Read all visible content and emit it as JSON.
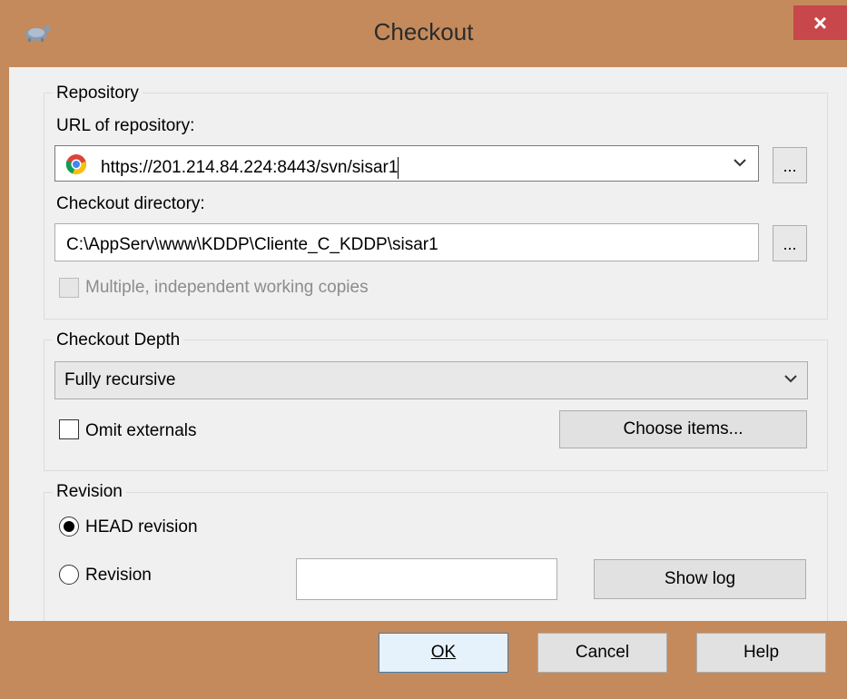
{
  "window": {
    "title": "Checkout",
    "close_label": "×"
  },
  "repository": {
    "group_label": "Repository",
    "url_label": "URL of repository:",
    "url_value": "https://201.214.84.224:8443/svn/sisar1",
    "browse_url_label": "...",
    "dir_label": "Checkout directory:",
    "dir_value": "C:\\AppServ\\www\\KDDP\\Cliente_C_KDDP\\sisar1",
    "browse_dir_label": "...",
    "multiple_copies_label": "Multiple, independent working copies"
  },
  "depth": {
    "group_label": "Checkout Depth",
    "selected": "Fully recursive",
    "omit_externals_label": "Omit externals",
    "choose_items_label": "Choose items..."
  },
  "revision": {
    "group_label": "Revision",
    "head_label": "HEAD revision",
    "revision_label": "Revision",
    "revision_value": "",
    "show_log_label": "Show log"
  },
  "buttons": {
    "ok_label": "OK",
    "cancel_label": "Cancel",
    "help_label": "Help"
  },
  "colors": {
    "title_bar": "#c48a5c",
    "close_button": "#c7474a",
    "dialog_bg": "#f0f0f0",
    "default_button_border": "#3c7fb1"
  }
}
